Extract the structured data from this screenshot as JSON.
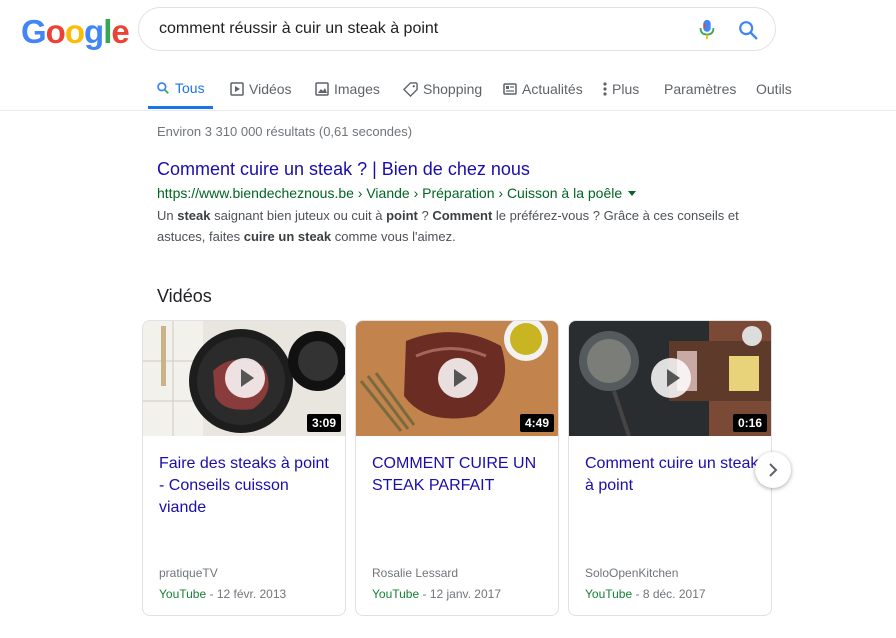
{
  "logo": {
    "letters": [
      "G",
      "o",
      "o",
      "g",
      "l",
      "e"
    ],
    "colors": [
      "#4285F4",
      "#EA4335",
      "#FBBC05",
      "#4285F4",
      "#34A853",
      "#EA4335"
    ]
  },
  "search": {
    "value": "comment réussir à cuir un steak à point",
    "mic_icon": "mic-icon",
    "search_icon": "search-icon"
  },
  "tabs": [
    {
      "label": "Tous",
      "icon": "search-icon",
      "active": true
    },
    {
      "label": "Vidéos",
      "icon": "video-icon"
    },
    {
      "label": "Images",
      "icon": "image-icon"
    },
    {
      "label": "Shopping",
      "icon": "tag-icon"
    },
    {
      "label": "Actualités",
      "icon": "news-icon"
    },
    {
      "label": "Plus",
      "icon": "more-vert-icon"
    },
    {
      "label": "Paramètres"
    },
    {
      "label": "Outils"
    }
  ],
  "stats": "Environ 3 310 000 résultats (0,61 secondes)",
  "result": {
    "title": "Comment cuire un steak ? | Bien de chez nous",
    "url": "https://www.biendecheznous.be › Viande › Préparation › Cuisson à la poêle",
    "snippet": {
      "p1": "Un ",
      "b1": "steak",
      "p2": " saignant bien juteux ou cuit à ",
      "b2": "point",
      "p3": " ? ",
      "b3": "Comment",
      "p4": " le préférez-vous ? Grâce à ces conseils et astuces, faites ",
      "b4": "cuire un steak",
      "p5": " comme vous l'aimez."
    }
  },
  "videos": {
    "heading": "Vidéos",
    "items": [
      {
        "title": "Faire des steaks à point - Conseils cuisson viande",
        "duration": "3:09",
        "channel": "pratiqueTV",
        "source": "YouTube",
        "date": " - 12 févr. 2013"
      },
      {
        "title": "COMMENT CUIRE UN STEAK PARFAIT",
        "duration": "4:49",
        "channel": "Rosalie Lessard",
        "source": "YouTube",
        "date": " - 12 janv. 2017"
      },
      {
        "title": "Comment cuire un steak à point",
        "duration": "0:16",
        "channel": "SoloOpenKitchen",
        "source": "YouTube",
        "date": " - 8 déc. 2017"
      }
    ]
  },
  "next_icon": "chevron-right-icon"
}
